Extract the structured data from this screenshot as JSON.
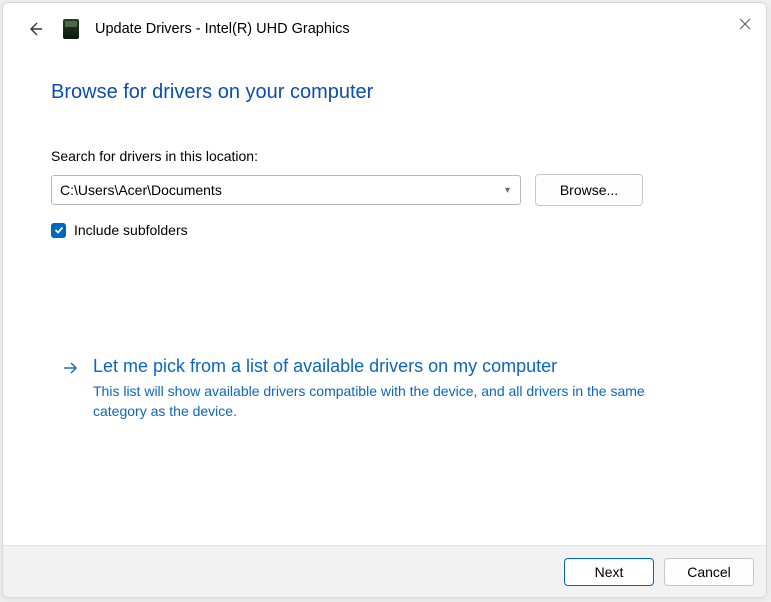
{
  "window": {
    "title": "Update Drivers - Intel(R) UHD Graphics"
  },
  "page": {
    "heading": "Browse for drivers on your computer",
    "search_label": "Search for drivers in this location:",
    "path_value": "C:\\Users\\Acer\\Documents",
    "browse_label": "Browse...",
    "include_subfolders_label": "Include subfolders",
    "include_subfolders_checked": true
  },
  "pick_option": {
    "title": "Let me pick from a list of available drivers on my computer",
    "description": "This list will show available drivers compatible with the device, and all drivers in the same category as the device."
  },
  "footer": {
    "next_label": "Next",
    "cancel_label": "Cancel"
  }
}
